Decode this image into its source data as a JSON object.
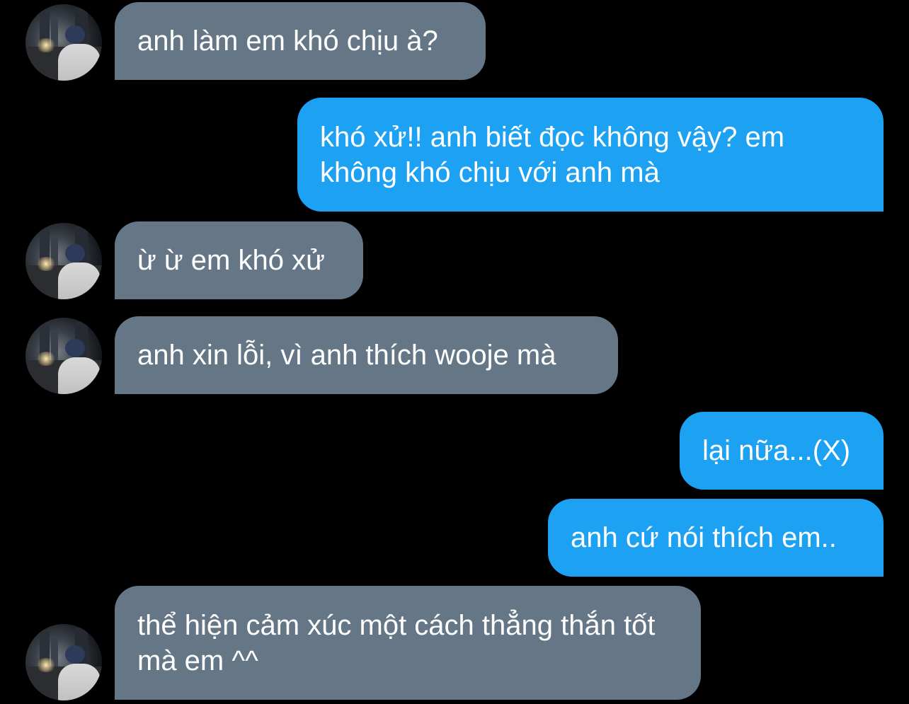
{
  "messages": [
    {
      "side": "received",
      "text": "anh làm em khó chịu à?"
    },
    {
      "side": "sent",
      "text": "khó xử!! anh biết đọc không vậy? em không khó chịu với anh mà"
    },
    {
      "side": "received",
      "text": "ừ ừ em khó xử"
    },
    {
      "side": "received",
      "text": "anh xin lỗi, vì anh thích wooje mà"
    },
    {
      "side": "sent",
      "text": "lại nữa...(X)"
    },
    {
      "side": "sent",
      "text": "anh cứ nói thích em.."
    },
    {
      "side": "received",
      "text": "thể hiện cảm xúc một cách thẳng thắn tốt mà em ^^"
    }
  ],
  "colors": {
    "background": "#000000",
    "received_bubble": "#657786",
    "sent_bubble": "#1da1f2",
    "text": "#ffffff"
  }
}
